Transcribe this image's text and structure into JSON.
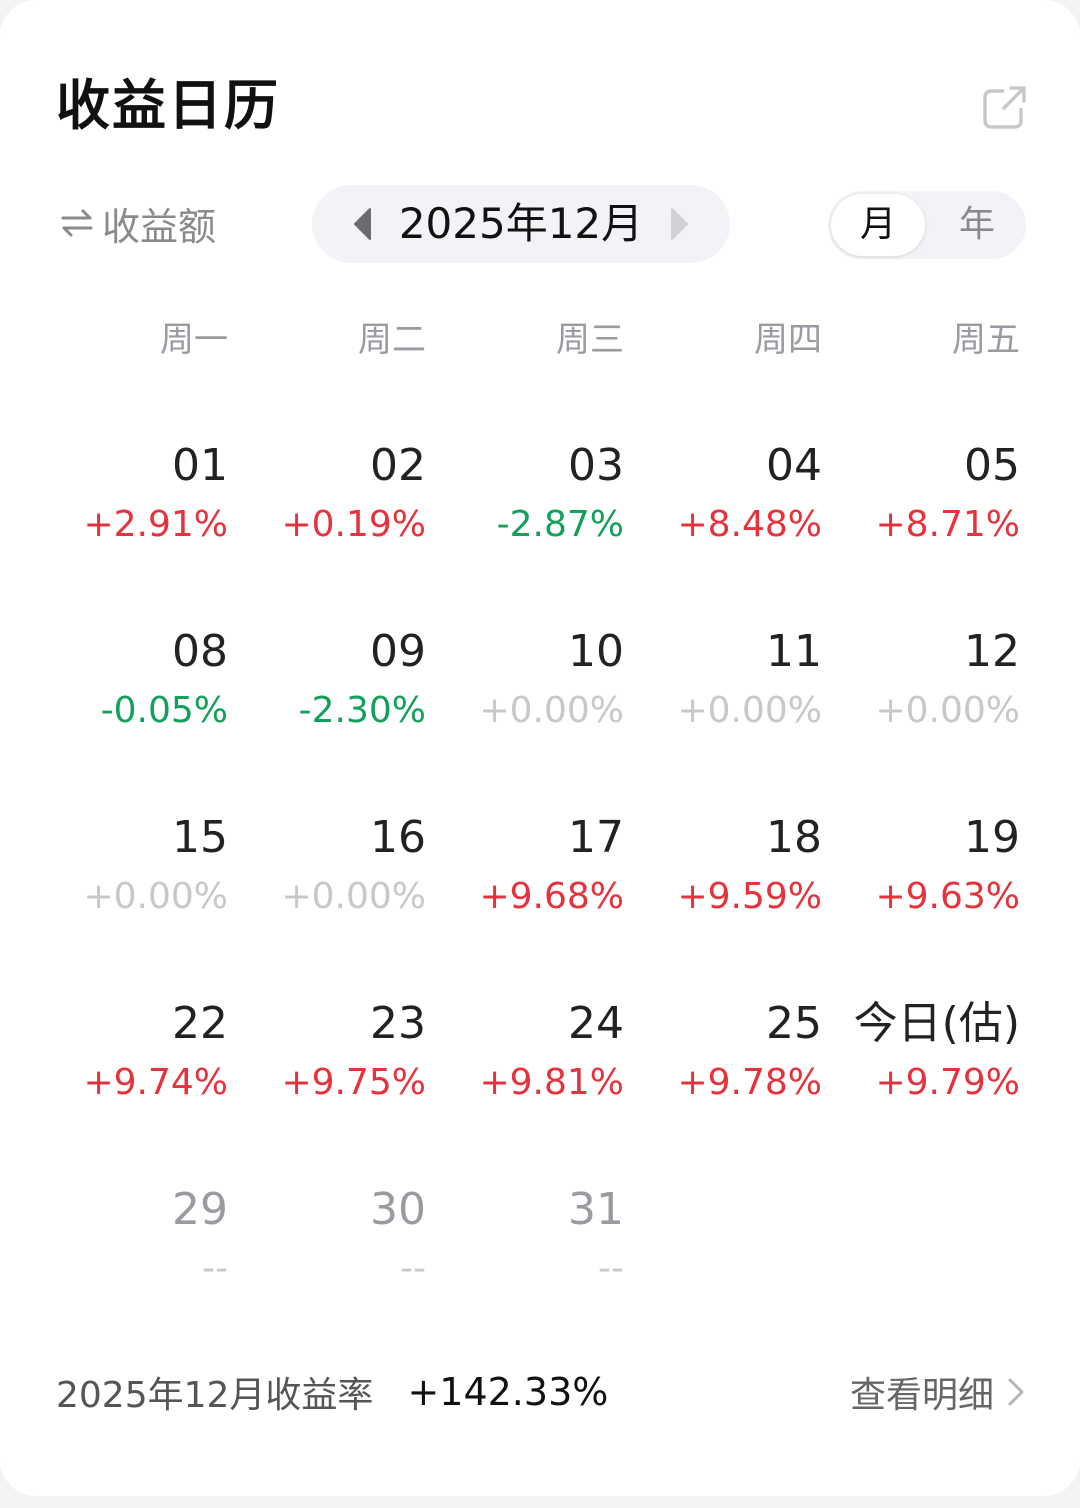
{
  "header": {
    "title": "收益日历"
  },
  "controls": {
    "metric_toggle_label": "收益额",
    "current_month": "2025年12月",
    "period_month": "月",
    "period_year": "年"
  },
  "weekdays": [
    "周一",
    "周二",
    "周三",
    "周四",
    "周五"
  ],
  "weeks": [
    [
      {
        "day": "01",
        "pct": "+2.91%",
        "trend": "up"
      },
      {
        "day": "02",
        "pct": "+0.19%",
        "trend": "up"
      },
      {
        "day": "03",
        "pct": "-2.87%",
        "trend": "down"
      },
      {
        "day": "04",
        "pct": "+8.48%",
        "trend": "up"
      },
      {
        "day": "05",
        "pct": "+8.71%",
        "trend": "up"
      }
    ],
    [
      {
        "day": "08",
        "pct": "-0.05%",
        "trend": "down"
      },
      {
        "day": "09",
        "pct": "-2.30%",
        "trend": "down"
      },
      {
        "day": "10",
        "pct": "+0.00%",
        "trend": "zero"
      },
      {
        "day": "11",
        "pct": "+0.00%",
        "trend": "zero"
      },
      {
        "day": "12",
        "pct": "+0.00%",
        "trend": "zero"
      }
    ],
    [
      {
        "day": "15",
        "pct": "+0.00%",
        "trend": "zero"
      },
      {
        "day": "16",
        "pct": "+0.00%",
        "trend": "zero"
      },
      {
        "day": "17",
        "pct": "+9.68%",
        "trend": "up"
      },
      {
        "day": "18",
        "pct": "+9.59%",
        "trend": "up"
      },
      {
        "day": "19",
        "pct": "+9.63%",
        "trend": "up"
      }
    ],
    [
      {
        "day": "22",
        "pct": "+9.74%",
        "trend": "up"
      },
      {
        "day": "23",
        "pct": "+9.75%",
        "trend": "up"
      },
      {
        "day": "24",
        "pct": "+9.81%",
        "trend": "up"
      },
      {
        "day": "25",
        "pct": "+9.78%",
        "trend": "up"
      },
      {
        "day": "今日(估)",
        "pct": "+9.79%",
        "trend": "up"
      }
    ],
    [
      {
        "day": "29",
        "pct": "--",
        "trend": "none",
        "future": true
      },
      {
        "day": "30",
        "pct": "--",
        "trend": "none",
        "future": true
      },
      {
        "day": "31",
        "pct": "--",
        "trend": "none",
        "future": true
      }
    ]
  ],
  "footer": {
    "summary_label": "2025年12月收益率",
    "summary_value": "+142.33%",
    "detail_link": "查看明细"
  },
  "colors": {
    "up": "#e6323c",
    "down": "#13a05a",
    "zero": "#c8c8cc"
  },
  "icons": {
    "share": "share-external-icon",
    "swap": "swap-arrows-icon",
    "prev": "triangle-left-icon",
    "next": "triangle-right-icon",
    "chevron": "chevron-right-icon"
  }
}
